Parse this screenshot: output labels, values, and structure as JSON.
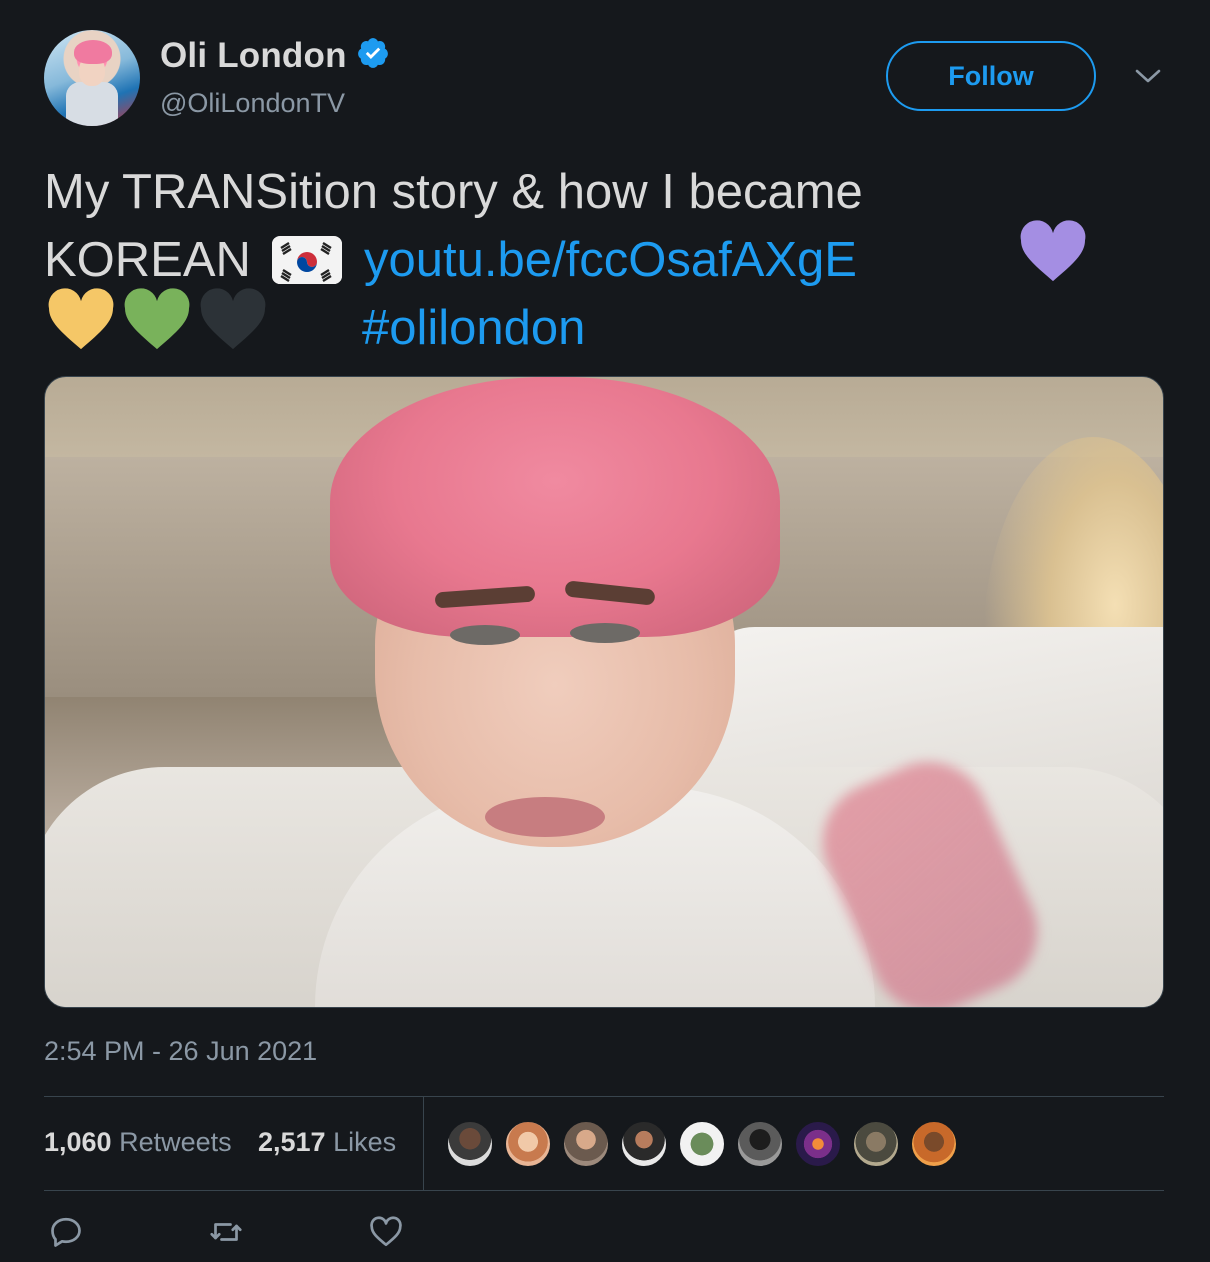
{
  "author": {
    "name": "Oli London",
    "handle": "@OliLondonTV",
    "verified_icon": "verified-badge-icon"
  },
  "header": {
    "follow_label": "Follow",
    "menu_icon": "chevron-down-icon"
  },
  "tweet": {
    "line1": "My TRANSition story & how I became",
    "line2_text": "KOREAN",
    "flag_emoji": "🇰🇷",
    "link": "youtu.be/fccOsafAXgE",
    "hashtag": "#olilondon",
    "hearts": [
      {
        "name": "purple-heart-icon",
        "color": "#a48ee3"
      },
      {
        "name": "yellow-heart-icon",
        "color": "#f5c767"
      },
      {
        "name": "green-heart-icon",
        "color": "#79b25b"
      },
      {
        "name": "black-heart-icon",
        "color": "#2c3237"
      }
    ]
  },
  "timestamp": "2:54 PM - 26 Jun 2021",
  "stats": {
    "retweets_count": "1,060",
    "retweets_label": "Retweets",
    "likes_count": "2,517",
    "likes_label": "Likes"
  },
  "likers": [
    {
      "name": "liker-avatar-1",
      "color": "#3b3b3b"
    },
    {
      "name": "liker-avatar-2",
      "color": "#d9a07e"
    },
    {
      "name": "liker-avatar-3",
      "color": "#6b5a4e"
    },
    {
      "name": "liker-avatar-4",
      "color": "#2a2a2a"
    },
    {
      "name": "liker-avatar-5",
      "color": "#f2f2f2"
    },
    {
      "name": "liker-avatar-6",
      "color": "#5b5b5b"
    },
    {
      "name": "liker-avatar-7",
      "color": "#7b2f8a"
    },
    {
      "name": "liker-avatar-8",
      "color": "#4b4a3f"
    },
    {
      "name": "liker-avatar-9",
      "color": "#c8692a"
    }
  ],
  "actions": [
    "reply-icon",
    "retweet-icon",
    "like-icon"
  ],
  "colors": {
    "background": "#15181c",
    "accent": "#1d9bf0",
    "text": "#d9d9d9",
    "muted": "#8b98a5",
    "border": "#38444d"
  }
}
